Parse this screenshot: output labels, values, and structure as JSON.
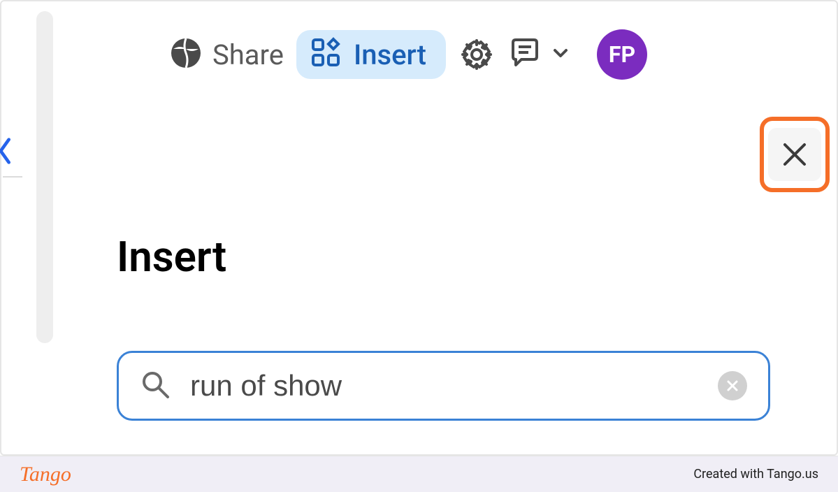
{
  "toolbar": {
    "share_label": "Share",
    "insert_label": "Insert"
  },
  "avatar": {
    "initials": "FP"
  },
  "panel": {
    "title": "Insert"
  },
  "search": {
    "value": "run of show",
    "placeholder": ""
  },
  "footer": {
    "brand": "Tango",
    "credit": "Created with Tango.us"
  },
  "colors": {
    "accent": "#f56e28",
    "insert_bg": "#d6ebfc",
    "insert_text": "#1a5fb4",
    "avatar_bg": "#7b2cbf",
    "search_border": "#3b82d6"
  }
}
